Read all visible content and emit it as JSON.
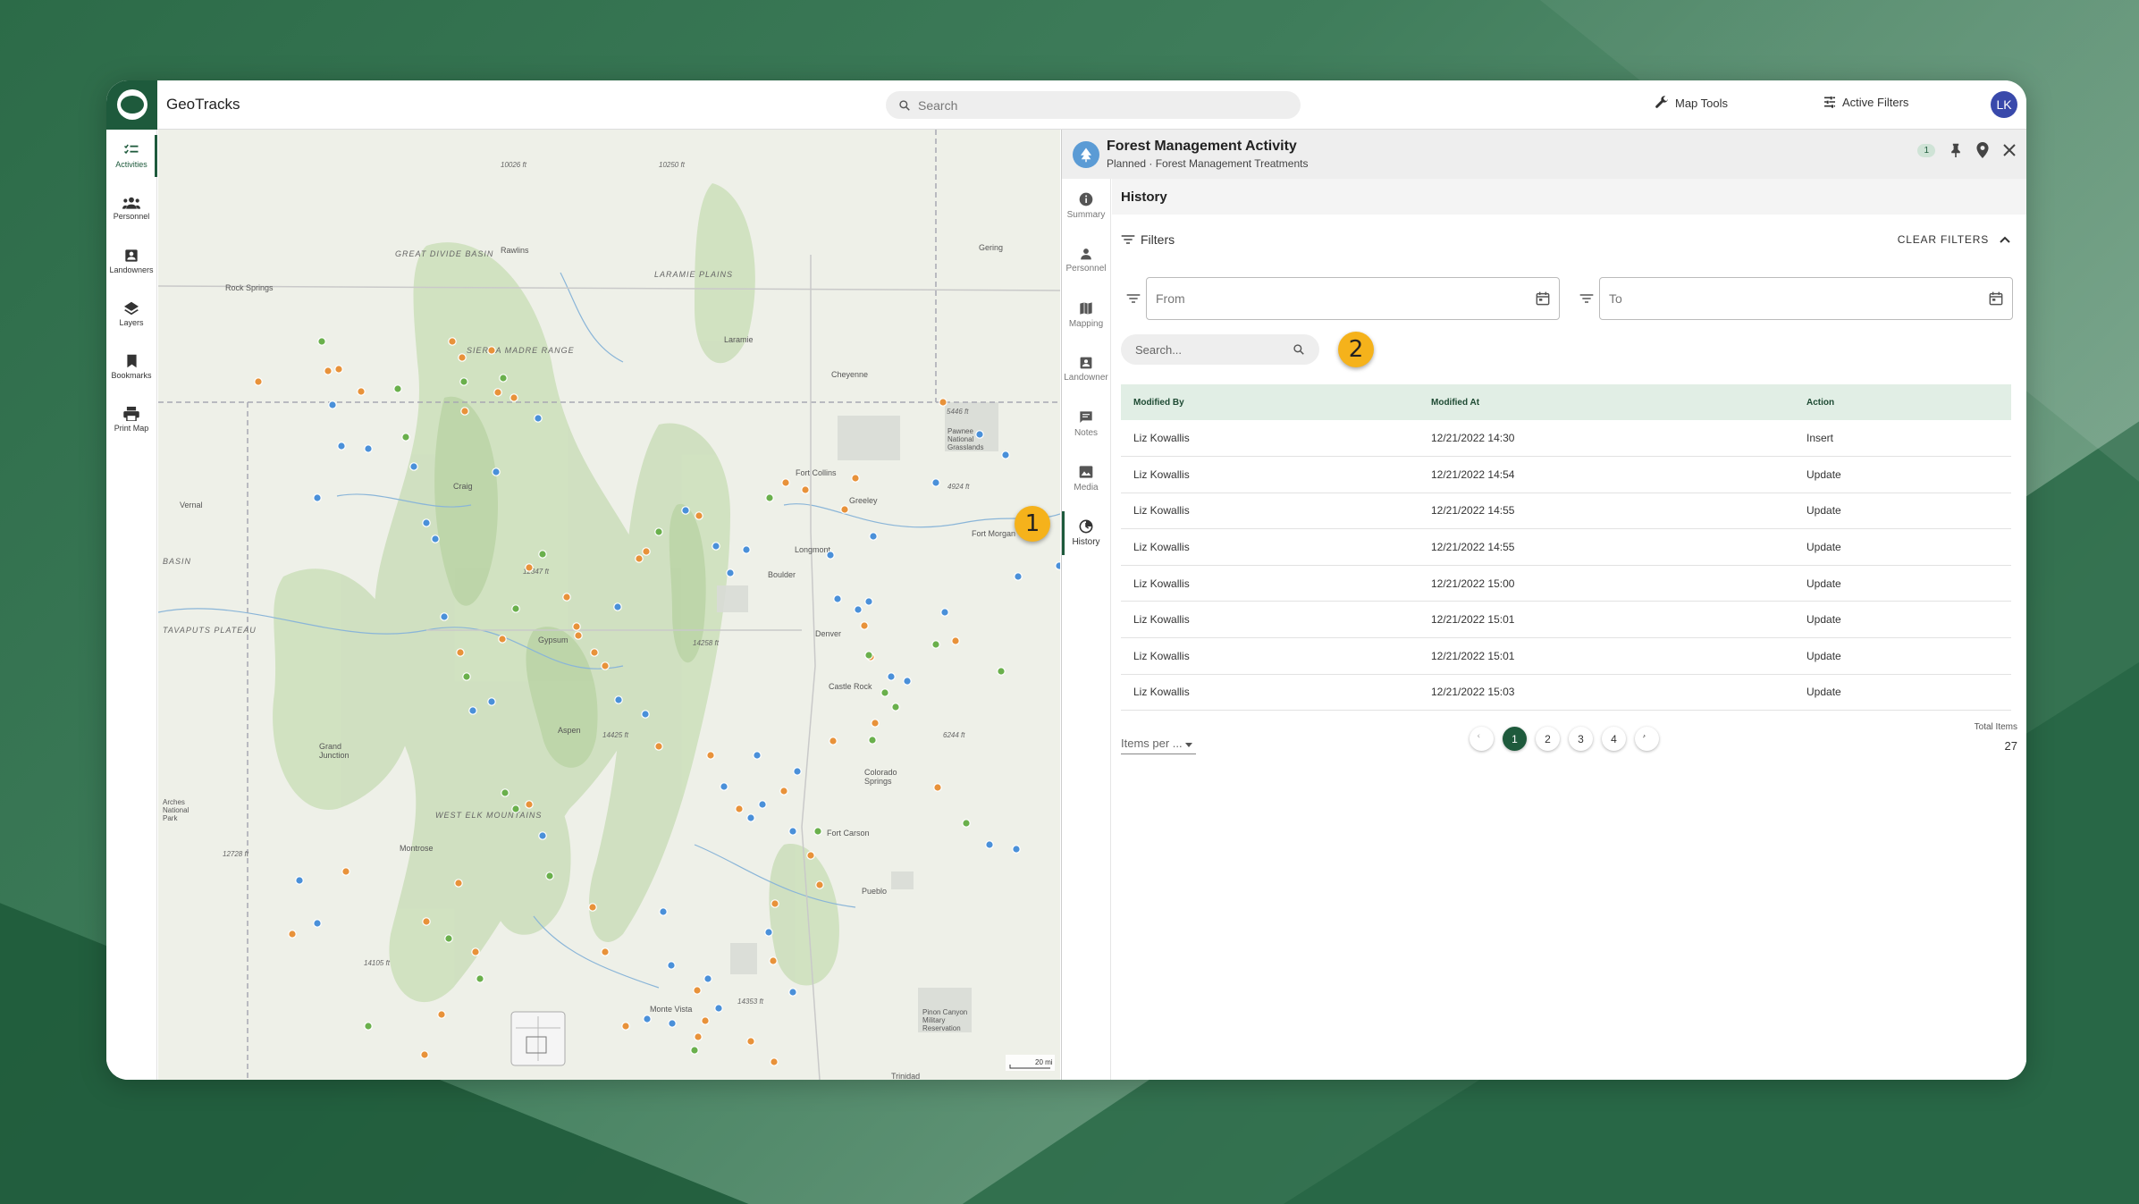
{
  "app": {
    "title": "GeoTracks",
    "search_placeholder": "Search",
    "map_tools": "Map Tools",
    "active_filters": "Active Filters",
    "avatar": "LK"
  },
  "rail": [
    {
      "label": "Activities",
      "icon": "activities-icon"
    },
    {
      "label": "Personnel",
      "icon": "personnel-icon"
    },
    {
      "label": "Landowners",
      "icon": "landowners-icon"
    },
    {
      "label": "Layers",
      "icon": "layers-icon"
    },
    {
      "label": "Bookmarks",
      "icon": "bookmark-icon"
    },
    {
      "label": "Print Map",
      "icon": "print-icon"
    }
  ],
  "map": {
    "labels": [
      "GREAT DIVIDE BASIN",
      "Rawlins",
      "Rock Springs",
      "LARAMIE PLAINS",
      "Laramie",
      "Cheyenne",
      "Gering",
      "SIERRA MADRE RANGE",
      "Fort Collins",
      "Greeley",
      "Fort Morgan",
      "Vernal",
      "Craig",
      "Longmont",
      "Boulder",
      "Denver",
      "Castle Rock",
      "TAVAPUTS PLATEAU",
      "Aspen",
      "Gypsum",
      "Grand Junction",
      "Colorado Springs",
      "Montrose",
      "Fort Carson",
      "Pueblo",
      "WEST ELK MOUNTAINS",
      "Monte Vista",
      "Pinon Canyon Military Reservation",
      "Trinidad",
      "BASIN",
      "Pawnee National Grasslands",
      "Arches National Park",
      "10026 ft",
      "10250 ft",
      "12347 ft",
      "14258 ft",
      "14425 ft",
      "12728 ft",
      "14105 ft",
      "14353 ft",
      "6244 ft",
      "4924 ft",
      "5446 ft"
    ],
    "scale": "20 mi"
  },
  "panel": {
    "title": "Forest Management Activity",
    "subtitle": "Planned · Forest Management Treatments",
    "badge": "1",
    "tabs": [
      {
        "label": "Summary"
      },
      {
        "label": "Personnel"
      },
      {
        "label": "Mapping"
      },
      {
        "label": "Landowner"
      },
      {
        "label": "Notes"
      },
      {
        "label": "Media"
      },
      {
        "label": "History"
      }
    ],
    "section": "History",
    "filters_label": "Filters",
    "clear_filters": "CLEAR FILTERS",
    "from_label": "From",
    "to_label": "To",
    "search_placeholder": "Search...",
    "table": {
      "headers": [
        "Modified By",
        "Modified At",
        "Action"
      ],
      "rows": [
        [
          "Liz Kowallis",
          "12/21/2022 14:30",
          "Insert"
        ],
        [
          "Liz Kowallis",
          "12/21/2022 14:54",
          "Update"
        ],
        [
          "Liz Kowallis",
          "12/21/2022 14:55",
          "Update"
        ],
        [
          "Liz Kowallis",
          "12/21/2022 14:55",
          "Update"
        ],
        [
          "Liz Kowallis",
          "12/21/2022 15:00",
          "Update"
        ],
        [
          "Liz Kowallis",
          "12/21/2022 15:01",
          "Update"
        ],
        [
          "Liz Kowallis",
          "12/21/2022 15:01",
          "Update"
        ],
        [
          "Liz Kowallis",
          "12/21/2022 15:03",
          "Update"
        ]
      ]
    },
    "items_per_page": "Items per ...",
    "pages": [
      "1",
      "2",
      "3",
      "4"
    ],
    "current_page": "1",
    "total_label": "Total Items",
    "total_value": "27"
  },
  "callouts": [
    "1",
    "2"
  ],
  "colors": {
    "brand": "#1e5a3c",
    "callout": "#f5b21b",
    "dot_orange": "#e8923a",
    "dot_blue": "#4a90d9",
    "dot_green": "#6ab04c"
  }
}
